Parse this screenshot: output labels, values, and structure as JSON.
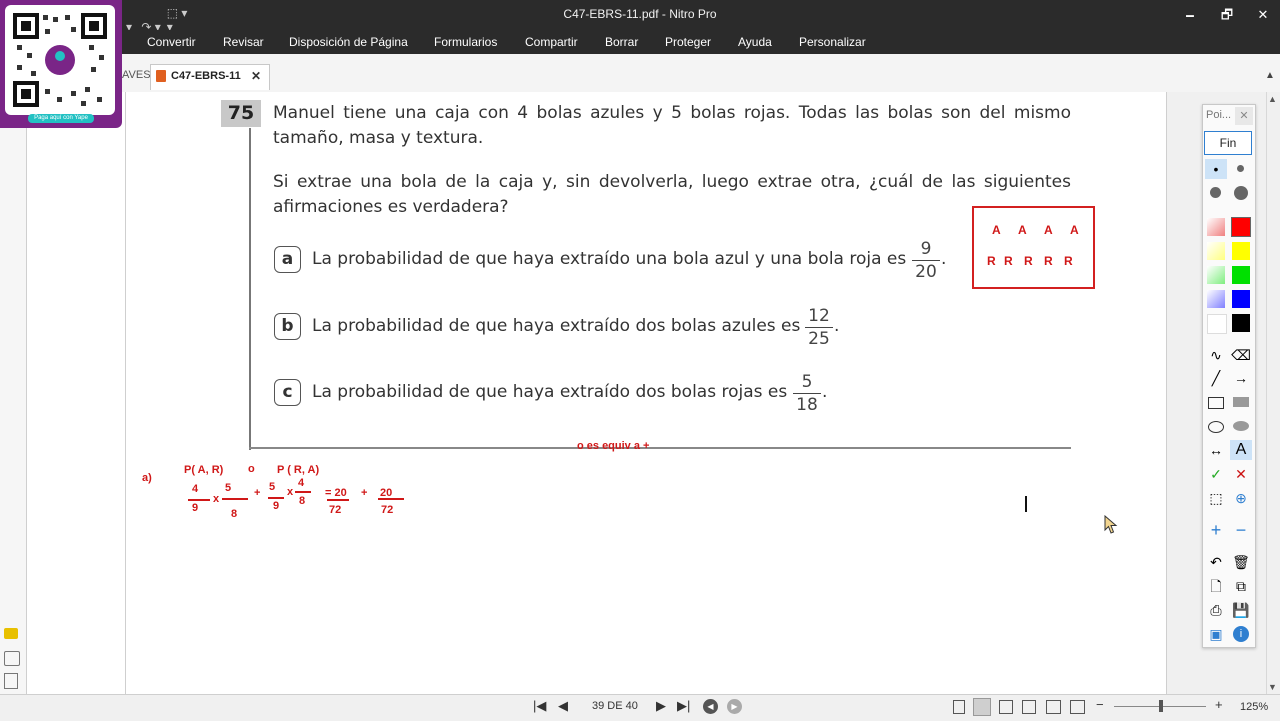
{
  "window": {
    "title": "C47-EBRS-11.pdf - Nitro Pro",
    "minimize": "🗕",
    "restore": "🗗",
    "close": "✕"
  },
  "menu": [
    "Convertir",
    "Revisar",
    "Disposición de Página",
    "Formularios",
    "Compartir",
    "Borrar",
    "Proteger",
    "Ayuda",
    "Personalizar"
  ],
  "tabs": {
    "partial": "AVES",
    "active": "C47-EBRS-11",
    "close": "✕"
  },
  "qr": {
    "caption": "Paga aquí con Yape"
  },
  "question": {
    "number": "75",
    "line1": "Manuel tiene una caja con 4 bolas azules y 5 bolas rojas. Todas las bolas son del mismo",
    "line2": "tamaño, masa y textura.",
    "line3": "Si extrae una bola de la caja y, sin devolverla, luego extrae otra, ¿cuál de las siguientes",
    "line4": "afirmaciones es verdadera?",
    "options": [
      {
        "letter": "a",
        "text": "La probabilidad de que haya extraído una bola azul y una bola roja es",
        "num": "9",
        "den": "20"
      },
      {
        "letter": "b",
        "text": "La probabilidad de que haya extraído dos bolas azules es",
        "num": "12",
        "den": "25"
      },
      {
        "letter": "c",
        "text": "La probabilidad de que haya extraído dos bolas rojas es",
        "num": "5",
        "den": "18"
      }
    ]
  },
  "annotations": {
    "box_row1": [
      "A",
      "A",
      "A",
      "A"
    ],
    "box_row2": [
      "R",
      "R",
      "R",
      "R",
      "R"
    ],
    "note": "o es equiv a +",
    "a_label": "a)",
    "p_ar": "P( A, R)",
    "o": "o",
    "p_ra": "P ( R, A)",
    "f1n": "4",
    "f1d": "9",
    "x1": "x",
    "f2n": "5",
    "f2d": "8",
    "plus1": "+",
    "f3n": "5",
    "f3d": "9",
    "x2": "x",
    "f4n": "4",
    "f4d": "8",
    "eq": "= 20",
    "f5d": "72",
    "plus2": "+",
    "f6n": "20",
    "f6d": "72"
  },
  "toolpanel": {
    "title": "Poi...",
    "close": "✕",
    "fin": "Fin"
  },
  "colors": {
    "swatches": [
      "#f08080",
      "#ff0000",
      "#ffff80",
      "#ffff00",
      "#80ee80",
      "#00e000",
      "#8080ff",
      "#0000ff",
      "#ffffff",
      "#000000"
    ],
    "annotation_red": "#d01818"
  },
  "status": {
    "page": "39 DE 40",
    "zoom": "125%",
    "zoom_minus": "−",
    "zoom_plus": "+"
  }
}
